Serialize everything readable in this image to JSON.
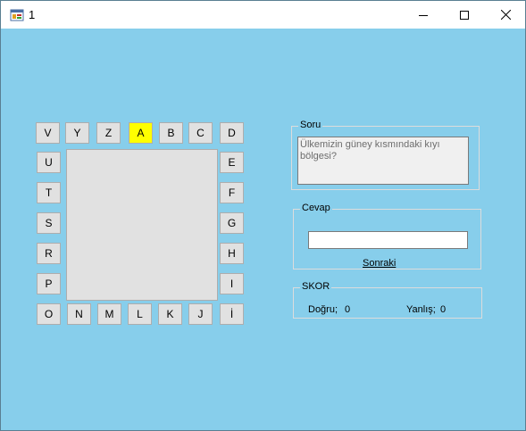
{
  "window": {
    "title": "1"
  },
  "letters": {
    "top": [
      "V",
      "Y",
      "Z",
      "A",
      "B",
      "C",
      "D"
    ],
    "left": [
      "U",
      "T",
      "S",
      "R",
      "P"
    ],
    "right": [
      "E",
      "F",
      "G",
      "H",
      "I"
    ],
    "bottom": [
      "O",
      "N",
      "M",
      "L",
      "K",
      "J",
      "İ"
    ],
    "active": "A",
    "active_color": "#FFFF00"
  },
  "soru": {
    "legend": "Soru",
    "text": "Ülkemizin güney kısmındaki kıyı bölgesi?"
  },
  "cevap": {
    "legend": "Cevap",
    "value": "",
    "button": "Sonraki"
  },
  "skor": {
    "legend": "SKOR",
    "dogru_label": "Doğru;",
    "dogru_value": "0",
    "yanlis_label": "Yanlış;",
    "yanlis_value": "0"
  },
  "colors": {
    "background": "#87CEEB",
    "button_face": "#E1E1E1"
  }
}
